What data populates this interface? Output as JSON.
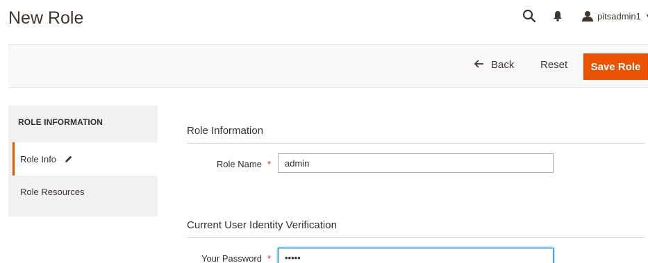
{
  "page": {
    "title": "New Role"
  },
  "header": {
    "username": "pitsadmin1"
  },
  "actions": {
    "back_label": "Back",
    "reset_label": "Reset",
    "save_label": "Save Role"
  },
  "sidebar": {
    "title": "ROLE INFORMATION",
    "tabs": [
      {
        "label": "Role Info",
        "active": true
      },
      {
        "label": "Role Resources",
        "active": false
      }
    ]
  },
  "form": {
    "section1_title": "Role Information",
    "role_name": {
      "label": "Role Name",
      "required_mark": "*",
      "value": "admin"
    },
    "section2_title": "Current User Identity Verification",
    "password": {
      "label": "Your Password",
      "required_mark": "*",
      "value": "•••••"
    }
  },
  "colors": {
    "accent": "#eb5202",
    "required": "#e22626",
    "focus": "#007bdb"
  },
  "icons": [
    "search-icon",
    "bell-icon",
    "user-icon",
    "chevron-down-icon",
    "arrow-left-icon",
    "pencil-icon"
  ]
}
